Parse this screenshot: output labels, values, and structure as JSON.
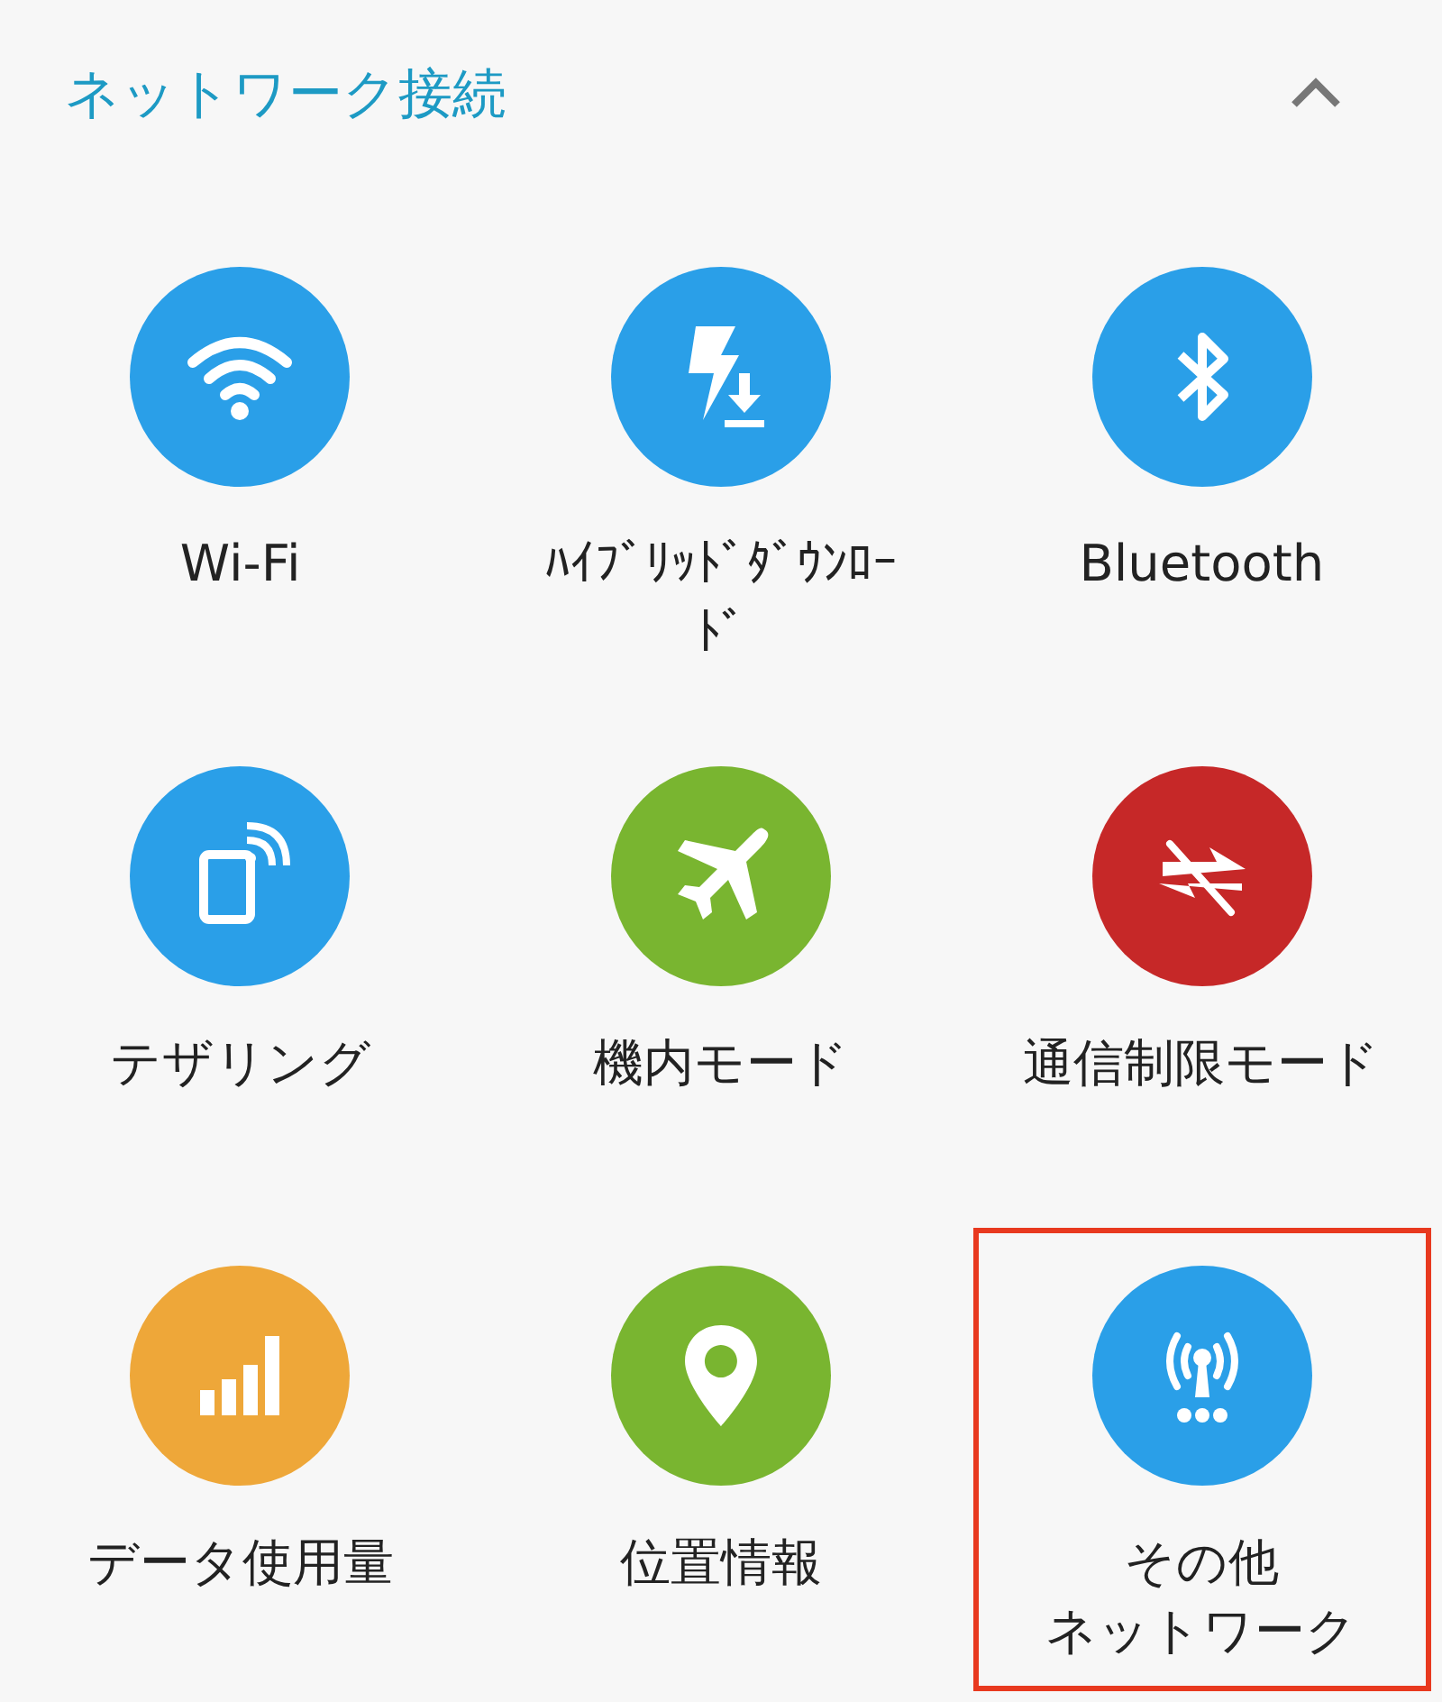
{
  "section": {
    "title": "ネットワーク接続",
    "expanded": true
  },
  "tiles": [
    {
      "label": [
        "Wi-Fi"
      ],
      "color": "#2a9fe8",
      "highlighted": false
    },
    {
      "label": [
        "ﾊｲﾌﾞﾘｯﾄﾞﾀﾞｳﾝﾛｰﾄﾞ"
      ],
      "color": "#2a9fe8",
      "highlighted": false
    },
    {
      "label": [
        "Bluetooth"
      ],
      "color": "#2a9fe8",
      "highlighted": false
    },
    {
      "label": [
        "テザリング"
      ],
      "color": "#2a9fe8",
      "highlighted": false
    },
    {
      "label": [
        "機内モード"
      ],
      "color": "#79b530",
      "highlighted": false
    },
    {
      "label": [
        "通信制限モード"
      ],
      "color": "#c62828",
      "highlighted": false
    },
    {
      "label": [
        "データ使用量"
      ],
      "color": "#eea739",
      "highlighted": false
    },
    {
      "label": [
        "位置情報"
      ],
      "color": "#79b530",
      "highlighted": false
    },
    {
      "label": [
        "その他",
        "ネットワーク"
      ],
      "color": "#2a9fe8",
      "highlighted": true
    }
  ]
}
